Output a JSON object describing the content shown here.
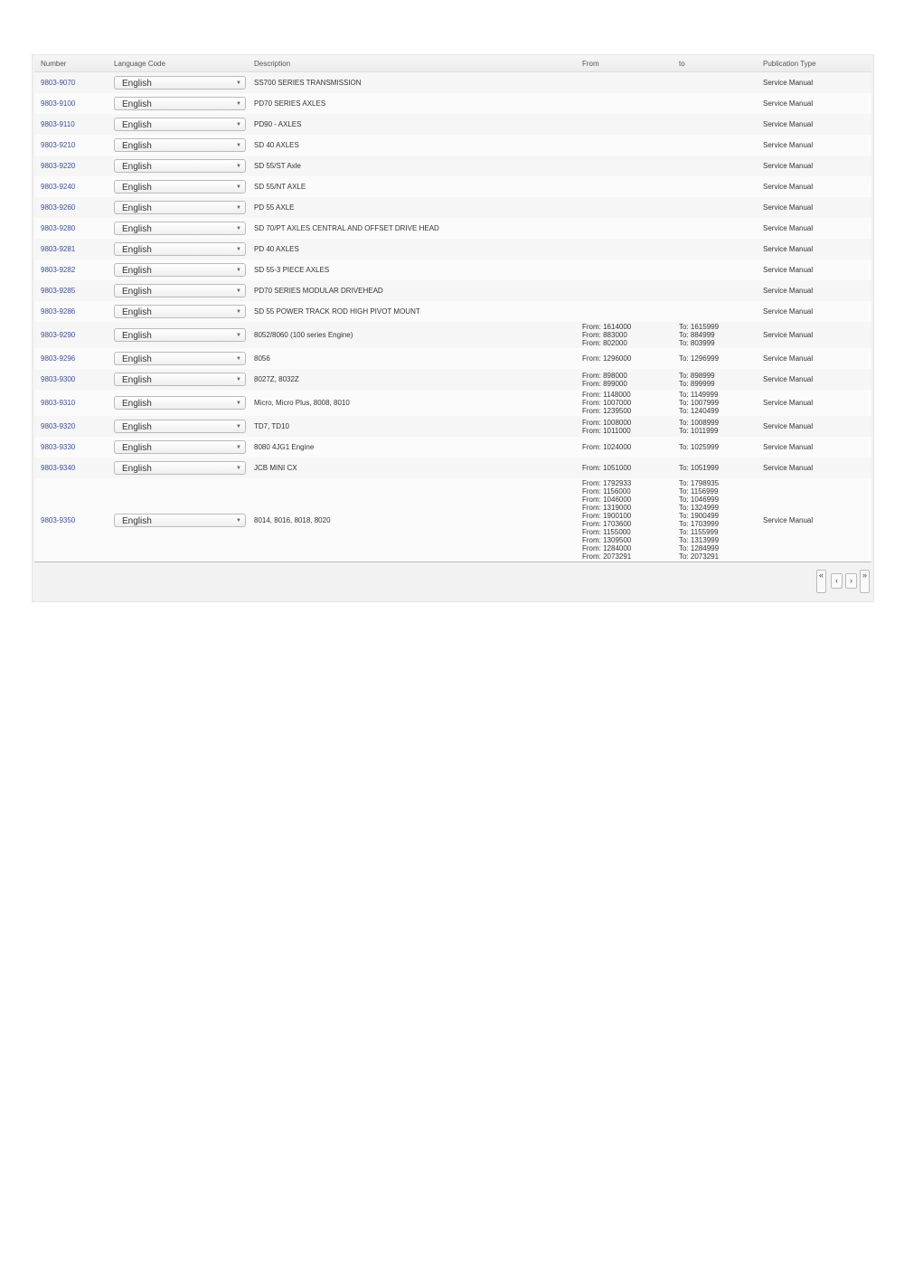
{
  "columns": {
    "number": "Number",
    "language": "Language Code",
    "description": "Description",
    "from": "From",
    "to": "to",
    "type": "Publication Type"
  },
  "rows": [
    {
      "number": "9803-9070",
      "language": "English",
      "description": "SS700 SERIES TRANSMISSION",
      "from": [],
      "to": [],
      "type": "Service Manual"
    },
    {
      "number": "9803-9100",
      "language": "English",
      "description": "PD70 SERIES AXLES",
      "from": [],
      "to": [],
      "type": "Service Manual"
    },
    {
      "number": "9803-9110",
      "language": "English",
      "description": "PD90 - AXLES",
      "from": [],
      "to": [],
      "type": "Service Manual"
    },
    {
      "number": "9803-9210",
      "language": "English",
      "description": "SD 40 AXLES",
      "from": [],
      "to": [],
      "type": "Service Manual"
    },
    {
      "number": "9803-9220",
      "language": "English",
      "description": "SD 55/ST Axle",
      "from": [],
      "to": [],
      "type": "Service Manual"
    },
    {
      "number": "9803-9240",
      "language": "English",
      "description": "SD 55/NT AXLE",
      "from": [],
      "to": [],
      "type": "Service Manual"
    },
    {
      "number": "9803-9260",
      "language": "English",
      "description": "PD 55 AXLE",
      "from": [],
      "to": [],
      "type": "Service Manual"
    },
    {
      "number": "9803-9280",
      "language": "English",
      "description": "SD 70/PT AXLES CENTRAL AND OFFSET DRIVE HEAD",
      "from": [],
      "to": [],
      "type": "Service Manual"
    },
    {
      "number": "9803-9281",
      "language": "English",
      "description": "PD 40 AXLES",
      "from": [],
      "to": [],
      "type": "Service Manual"
    },
    {
      "number": "9803-9282",
      "language": "English",
      "description": "SD 55-3 PIECE AXLES",
      "from": [],
      "to": [],
      "type": "Service Manual"
    },
    {
      "number": "9803-9285",
      "language": "English",
      "description": "PD70 SERIES MODULAR DRIVEHEAD",
      "from": [],
      "to": [],
      "type": "Service Manual"
    },
    {
      "number": "9803-9286",
      "language": "English",
      "description": "SD 55 POWER TRACK ROD HIGH PIVOT MOUNT",
      "from": [],
      "to": [],
      "type": "Service Manual"
    },
    {
      "number": "9803-9290",
      "language": "English",
      "description": "8052/8060 (100 series Engine)",
      "from": [
        "From: 1614000",
        "From: 883000",
        "From: 802000"
      ],
      "to": [
        "To: 1615999",
        "To: 884999",
        "To: 803999"
      ],
      "type": "Service Manual"
    },
    {
      "number": "9803-9296",
      "language": "English",
      "description": "8056",
      "from": [
        "From: 1296000"
      ],
      "to": [
        "To: 1296999"
      ],
      "type": "Service Manual"
    },
    {
      "number": "9803-9300",
      "language": "English",
      "description": "8027Z, 8032Z",
      "from": [
        "From: 898000",
        "From: 899000"
      ],
      "to": [
        "To: 898999",
        "To: 899999"
      ],
      "type": "Service Manual"
    },
    {
      "number": "9803-9310",
      "language": "English",
      "description": "Micro, Micro Plus, 8008, 8010",
      "from": [
        "From: 1148000",
        "From: 1007000",
        "From: 1239500"
      ],
      "to": [
        "To: 1149999",
        "To: 1007999",
        "To: 1240499"
      ],
      "type": "Service Manual"
    },
    {
      "number": "9803-9320",
      "language": "English",
      "description": "TD7, TD10",
      "from": [
        "From: 1008000",
        "From: 1011000"
      ],
      "to": [
        "To: 1008999",
        "To: 1011999"
      ],
      "type": "Service Manual"
    },
    {
      "number": "9803-9330",
      "language": "English",
      "description": "8080 4JG1 Engine",
      "from": [
        "From: 1024000"
      ],
      "to": [
        "To: 1025999"
      ],
      "type": "Service Manual"
    },
    {
      "number": "9803-9340",
      "language": "English",
      "description": "JCB MINI CX",
      "from": [
        "From: 1051000"
      ],
      "to": [
        "To: 1051999"
      ],
      "type": "Service Manual"
    },
    {
      "number": "9803-9350",
      "language": "English",
      "description": "8014, 8016, 8018, 8020",
      "from": [
        "From: 1792933",
        "From: 1156000",
        "From: 1046000",
        "From: 1319000",
        "From: 1900100",
        "From: 1703600",
        "From: 1155000",
        "From: 1309500",
        "From: 1284000",
        "From: 2073291"
      ],
      "to": [
        "To: 1798935",
        "To: 1156999",
        "To: 1046999",
        "To: 1324999",
        "To: 1900499",
        "To: 1703999",
        "To: 1155999",
        "To: 1313999",
        "To: 1284999",
        "To: 2073291"
      ],
      "type": "Service Manual"
    }
  ],
  "pagination": {
    "first": "«",
    "prev": "‹",
    "next": "›",
    "last": "»"
  }
}
